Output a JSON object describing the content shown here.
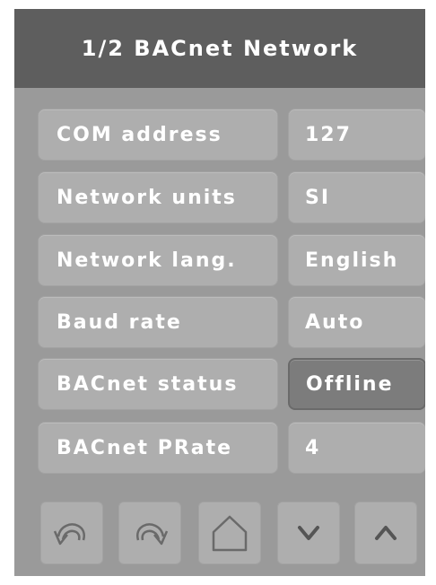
{
  "header": {
    "title": "1/2 BACnet Network"
  },
  "rows": [
    {
      "label": "COM address",
      "value": "127"
    },
    {
      "label": "Network units",
      "value": "SI"
    },
    {
      "label": "Network lang.",
      "value": "English"
    },
    {
      "label": "Baud rate",
      "value": "Auto"
    },
    {
      "label": "BACnet status",
      "value": "Offline",
      "selected": true
    },
    {
      "label": "BACnet PRate",
      "value": "4"
    }
  ],
  "nav": {
    "icons": [
      "undo-icon",
      "redo-icon",
      "home-icon",
      "chevron-down-icon",
      "chevron-up-icon"
    ]
  },
  "colors": {
    "panel": "#9a9a9a",
    "header": "#5e5e5e",
    "button": "#aeaeae",
    "selected_button": "#7c7c7c",
    "text": "#ffffff"
  }
}
